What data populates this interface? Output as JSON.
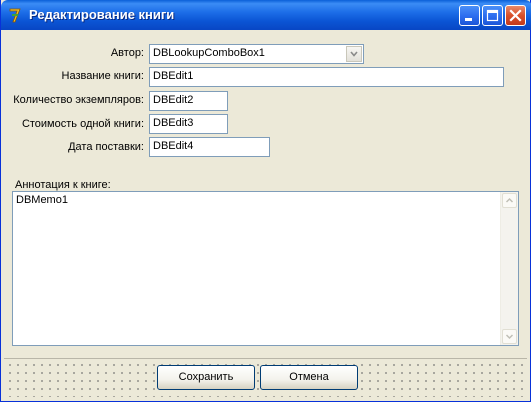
{
  "window": {
    "title": "Редактирование книги"
  },
  "form": {
    "author_label": "Автор:",
    "author_value": "DBLookupComboBox1",
    "title_label": "Название книги:",
    "title_value": "DBEdit1",
    "count_label": "Количество экземпляров:",
    "count_value": "DBEdit2",
    "price_label": "Стоимость одной книги:",
    "price_value": "DBEdit3",
    "date_label": "Дата поставки:",
    "date_value": "DBEdit4",
    "annotation_label": "Аннотация к книге:",
    "annotation_value": "DBMemo1"
  },
  "buttons": {
    "save_label": "Сохранить",
    "cancel_label": "Отмена"
  },
  "icons": {
    "app": "delphi-app-icon",
    "minimize": "minimize-icon",
    "maximize": "maximize-icon",
    "close": "close-icon",
    "dropdown": "chevron-down-icon",
    "scroll_up": "scroll-up-icon",
    "scroll_down": "scroll-down-icon"
  },
  "colors": {
    "titlebar": "#0b55d5",
    "client_bg": "#ece9d8",
    "close_button": "#d9502a",
    "input_border": "#7f9db9"
  }
}
